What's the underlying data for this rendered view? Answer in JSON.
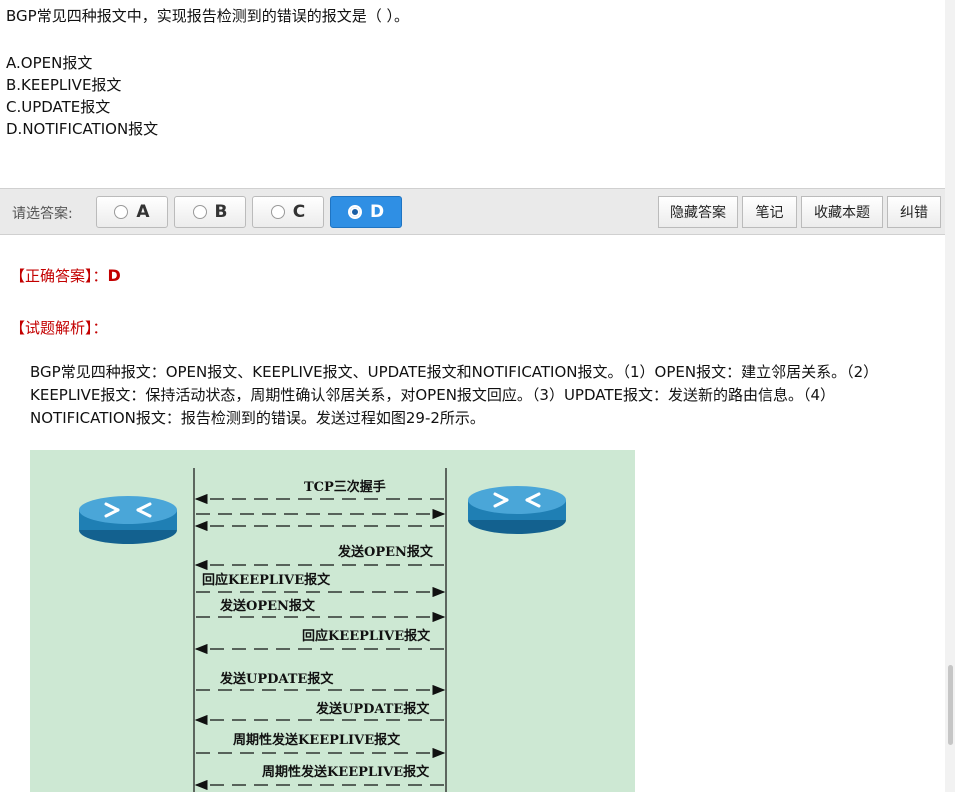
{
  "question": {
    "stem": "BGP常见四种报文中，实现报告检测到的错误的报文是（ ）。",
    "options": [
      "A.OPEN报文",
      "B.KEEPLIVE报文",
      "C.UPDATE报文",
      "D.NOTIFICATION报文"
    ]
  },
  "answer_bar": {
    "label": "请选答案:",
    "choices": [
      "A",
      "B",
      "C",
      "D"
    ],
    "selected": "D",
    "buttons": {
      "hide_answer": "隐藏答案",
      "notes": "笔记",
      "favorite": "收藏本题",
      "report_error": "纠错"
    }
  },
  "analysis": {
    "correct_label": "【正确答案】：",
    "correct_value": "D",
    "explain_label": "【试题解析】：",
    "explanation": "BGP常见四种报文：OPEN报文、KEEPLIVE报文、UPDATE报文和NOTIFICATION报文。（1）OPEN报文：建立邻居关系。（2）KEEPLIVE报文：保持活动状态，周期性确认邻居关系，对OPEN报文回应。（3）UPDATE报文：发送新的路由信息。（4）NOTIFICATION报文：报告检测到的错误。发送过程如图29-2所示。"
  },
  "diagram": {
    "labels": {
      "tcp": "TCP三次握手",
      "open_right": "发送OPEN报文",
      "keep_left": "回应KEEPLIVE报文",
      "open_left": "发送OPEN报文",
      "keep_right": "回应KEEPLIVE报文",
      "update_left": "发送UPDATE报文",
      "update_right": "发送UPDATE报文",
      "periodic_left": "周期性发送KEEPLIVE报文",
      "periodic_right": "周期性发送KEEPLIVE报文"
    },
    "colors": {
      "background": "#cde8d3",
      "router": "#1f7fb4"
    }
  }
}
